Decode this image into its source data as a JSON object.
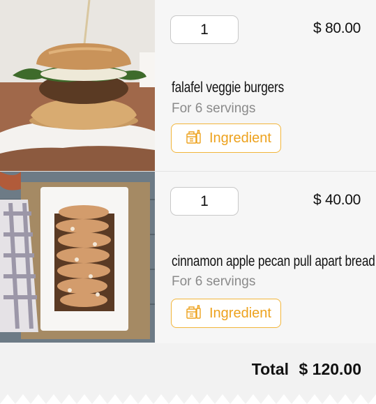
{
  "cart": {
    "items": [
      {
        "image_alt": "falafel veggie burger photo",
        "quantity": "1",
        "price": "$ 80.00",
        "name": "falafel veggie burgers",
        "servings": "For 6 servings",
        "ingredient_label": "Ingredient"
      },
      {
        "image_alt": "cinnamon apple pecan pull apart bread photo",
        "quantity": "1",
        "price": "$ 40.00",
        "name": "cinnamon apple pecan pull apart bread",
        "servings": "For 6 servings",
        "ingredient_label": "Ingredient"
      }
    ]
  },
  "footer": {
    "total_label": "Total",
    "total_value": "$ 120.00"
  },
  "colors": {
    "accent": "#f2b53a",
    "background": "#f6f6f6"
  },
  "icons": {
    "ingredient": "grocery-bag-icon"
  }
}
